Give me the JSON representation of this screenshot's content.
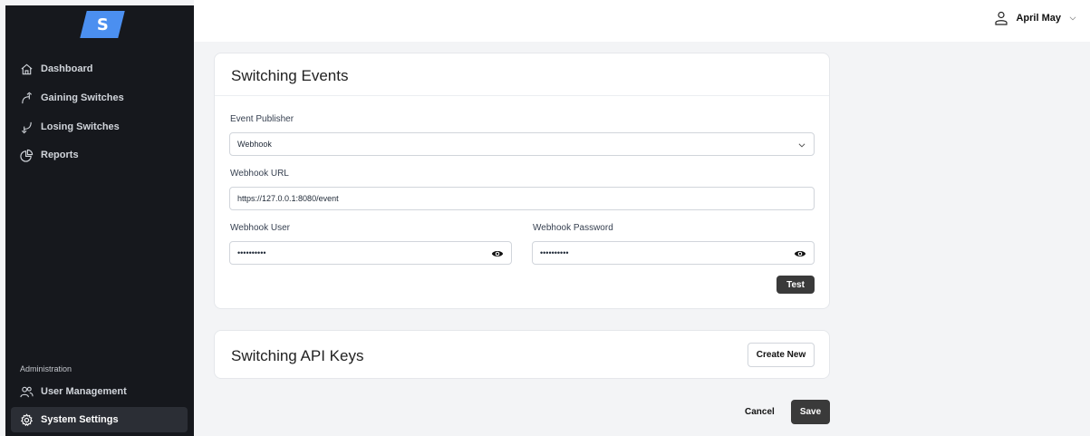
{
  "sidebar": {
    "logo_letter": "S",
    "items": [
      {
        "label": "Dashboard",
        "icon": "home-icon"
      },
      {
        "label": "Gaining Switches",
        "icon": "arrow-up-curve-icon"
      },
      {
        "label": "Losing Switches",
        "icon": "arrow-down-curve-icon"
      },
      {
        "label": "Reports",
        "icon": "pie-chart-icon"
      }
    ],
    "admin_label": "Administration",
    "admin_items": [
      {
        "label": "User Management",
        "icon": "users-icon"
      },
      {
        "label": "System Settings",
        "icon": "gear-icon",
        "active": true
      }
    ]
  },
  "header": {
    "user_name": "April May"
  },
  "events": {
    "title": "Switching Events",
    "publisher_label": "Event Publisher",
    "publisher_value": "Webhook",
    "url_label": "Webhook URL",
    "url_value": "https://127.0.0.1:8080/event",
    "user_label": "Webhook User",
    "user_value": "••••••••••",
    "password_label": "Webhook Password",
    "password_value": "••••••••••",
    "test_label": "Test"
  },
  "api_keys": {
    "title": "Switching API Keys",
    "create_label": "Create New"
  },
  "footer": {
    "cancel_label": "Cancel",
    "save_label": "Save"
  },
  "colors": {
    "sidebar_bg": "#16181d",
    "logo": "#4b8ff0",
    "button_dark": "#3a3a3a"
  }
}
